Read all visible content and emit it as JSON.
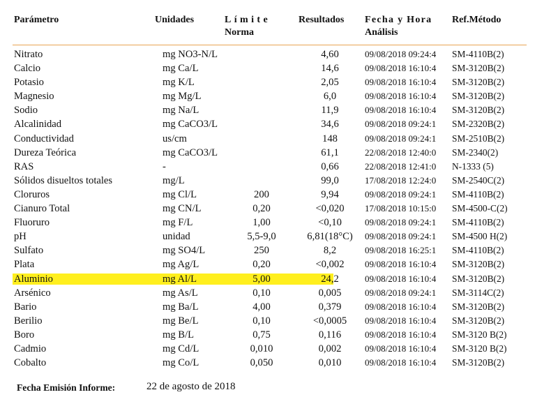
{
  "table": {
    "headers": {
      "parametro": "Parámetro",
      "unidades": "Unidades",
      "limite_l1": "Límite",
      "limite_l2": "Norma",
      "resultados": "Resultados",
      "fecha_l1": "Fecha y Hora",
      "fecha_l2": "Análisis",
      "ref": "Ref.Método"
    },
    "rows": [
      {
        "param": "Nitrato",
        "unit": "mg NO3-N/L",
        "limit": "",
        "result": "4,60",
        "date": "09/08/2018 09:24:4",
        "ref": "SM-4110B(2)"
      },
      {
        "param": "Calcio",
        "unit": "mg Ca/L",
        "limit": "",
        "result": "14,6",
        "date": "09/08/2018 16:10:4",
        "ref": "SM-3120B(2)"
      },
      {
        "param": "Potasio",
        "unit": "mg K/L",
        "limit": "",
        "result": "2,05",
        "date": "09/08/2018 16:10:4",
        "ref": "SM-3120B(2)"
      },
      {
        "param": "Magnesio",
        "unit": "mg Mg/L",
        "limit": "",
        "result": "6,0",
        "date": "09/08/2018 16:10:4",
        "ref": "SM-3120B(2)"
      },
      {
        "param": "Sodio",
        "unit": "mg Na/L",
        "limit": "",
        "result": "11,9",
        "date": "09/08/2018 16:10:4",
        "ref": "SM-3120B(2)"
      },
      {
        "param": "Alcalinidad",
        "unit": "mg CaCO3/L",
        "limit": "",
        "result": "34,6",
        "date": "09/08/2018 09:24:1",
        "ref": "SM-2320B(2)"
      },
      {
        "param": "Conductividad",
        "unit": "us/cm",
        "limit": "",
        "result": "148",
        "date": "09/08/2018 09:24:1",
        "ref": "SM-2510B(2)"
      },
      {
        "param": "Dureza Teórica",
        "unit": "mg CaCO3/L",
        "limit": "",
        "result": "61,1",
        "date": "22/08/2018 12:40:0",
        "ref": "SM-2340(2)"
      },
      {
        "param": "RAS",
        "unit": "-",
        "limit": "",
        "result": "0,66",
        "date": "22/08/2018 12:41:0",
        "ref": "N-1333 (5)"
      },
      {
        "param": "Sólidos disueltos totales",
        "unit": "mg/L",
        "limit": "",
        "result": "99,0",
        "date": "17/08/2018 12:24:0",
        "ref": "SM-2540C(2)"
      },
      {
        "param": "Cloruros",
        "unit": "mg Cl/L",
        "limit": "200",
        "result": "9,94",
        "date": "09/08/2018 09:24:1",
        "ref": "SM-4110B(2)"
      },
      {
        "param": "Cianuro Total",
        "unit": "mg CN/L",
        "limit": "0,20",
        "result": "<0,020",
        "date": "17/08/2018 10:15:0",
        "ref": "SM-4500-C(2)"
      },
      {
        "param": "Fluoruro",
        "unit": "mg F/L",
        "limit": "1,00",
        "result": "<0,10",
        "date": "09/08/2018 09:24:1",
        "ref": "SM-4110B(2)"
      },
      {
        "param": "pH",
        "unit": "unidad",
        "limit": "5,5-9,0",
        "result": "6,81(18°C)",
        "date": "09/08/2018 09:24:1",
        "ref": "SM-4500 H(2)"
      },
      {
        "param": "Sulfato",
        "unit": "mg SO4/L",
        "limit": "250",
        "result": "8,2",
        "date": "09/08/2018 16:25:1",
        "ref": "SM-4110B(2)"
      },
      {
        "param": "Plata",
        "unit": "mg Ag/L",
        "limit": "0,20",
        "result": "<0,002",
        "date": "09/08/2018 16:10:4",
        "ref": "SM-3120B(2)"
      },
      {
        "param": "Aluminio",
        "unit": "mg Al/L",
        "limit": "5,00",
        "result": "24,2",
        "date": "09/08/2018 16:10:4",
        "ref": "SM-3120B(2)",
        "highlight": true
      },
      {
        "param": "Arsénico",
        "unit": "mg As/L",
        "limit": "0,10",
        "result": "0,005",
        "date": "09/08/2018 09:24:1",
        "ref": "SM-3114C(2)"
      },
      {
        "param": "Bario",
        "unit": "mg Ba/L",
        "limit": "4,00",
        "result": "0,379",
        "date": "09/08/2018 16:10:4",
        "ref": "SM-3120B(2)"
      },
      {
        "param": "Berilio",
        "unit": "mg Be/L",
        "limit": "0,10",
        "result": "<0,0005",
        "date": "09/08/2018 16:10:4",
        "ref": "SM-3120B(2)"
      },
      {
        "param": "Boro",
        "unit": "mg B/L",
        "limit": "0,75",
        "result": "0,116",
        "date": "09/08/2018 16:10:4",
        "ref": "SM-3120 B(2)"
      },
      {
        "param": "Cadmio",
        "unit": "mg Cd/L",
        "limit": "0,010",
        "result": "0,002",
        "date": "09/08/2018 16:10:4",
        "ref": "SM-3120 B(2)"
      },
      {
        "param": "Cobalto",
        "unit": "mg Co/L",
        "limit": "0,050",
        "result": "0,010",
        "date": "09/08/2018 16:10:4",
        "ref": "SM-3120B(2)"
      }
    ]
  },
  "footer": {
    "label": "Fecha Emisión Informe:",
    "value": "22 de agosto de 2018"
  },
  "colors": {
    "highlight": "#ffef1e",
    "header_rule": "#e8a452"
  }
}
